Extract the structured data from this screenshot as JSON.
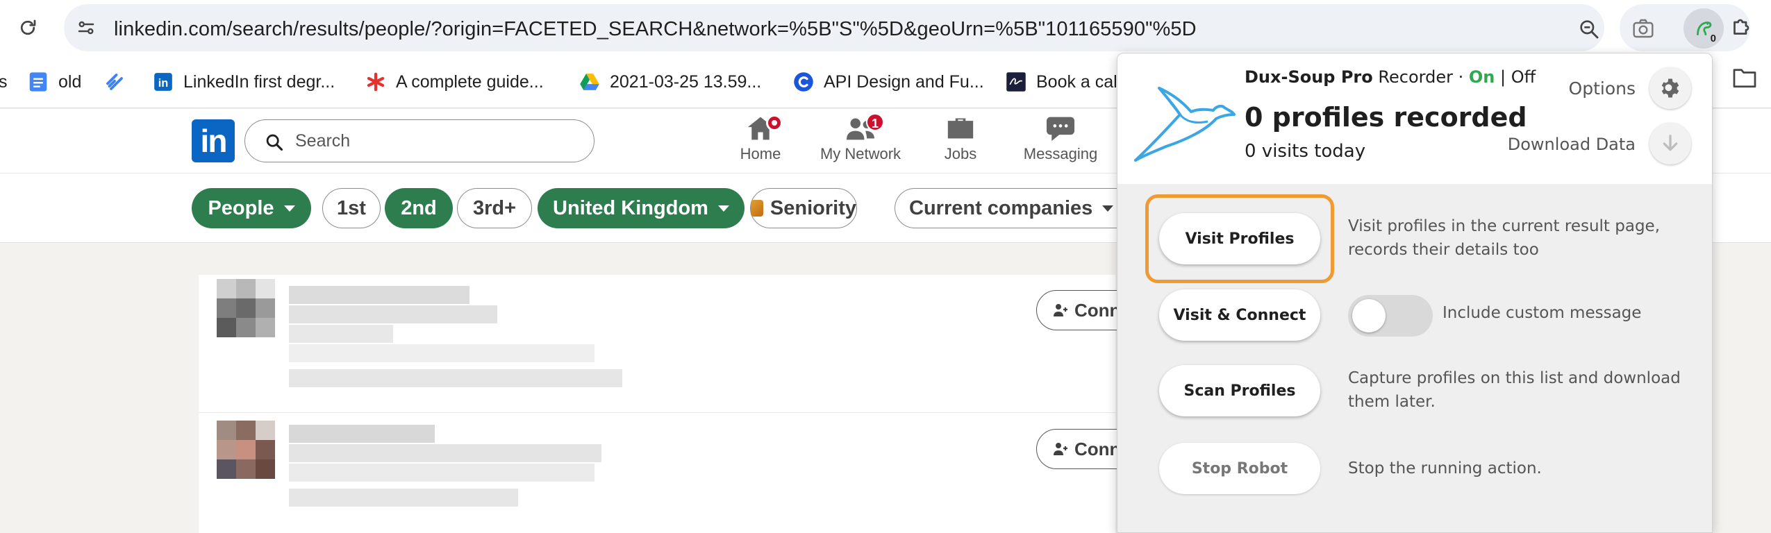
{
  "browser": {
    "url": "linkedin.com/search/results/people/?origin=FACETED_SEARCH&network=%5B\"S\"%5D&geoUrn=%5B\"101165590\"%5D",
    "extension_badge": "0"
  },
  "bookmarks": [
    {
      "label": "s",
      "icon": "partial"
    },
    {
      "label": "old",
      "icon": "docs-icon"
    },
    {
      "label": "",
      "icon": "zapier-like-icon"
    },
    {
      "label": "LinkedIn first degr...",
      "icon": "linkedin-icon"
    },
    {
      "label": "A complete guide...",
      "icon": "asterisk-icon"
    },
    {
      "label": "2021-03-25 13.59...",
      "icon": "drive-icon"
    },
    {
      "label": "API Design and Fu...",
      "icon": "c-icon"
    },
    {
      "label": "Book a cal",
      "icon": "signature-icon"
    }
  ],
  "linkedin": {
    "logo": "in",
    "search_placeholder": "Search",
    "nav": [
      {
        "label": "Home",
        "icon": "home-icon",
        "badge": "dot"
      },
      {
        "label": "My Network",
        "icon": "network-icon",
        "badge": "1"
      },
      {
        "label": "Jobs",
        "icon": "briefcase-icon"
      },
      {
        "label": "Messaging",
        "icon": "messaging-icon"
      }
    ],
    "filters": {
      "people": "People",
      "first": "1st",
      "second": "2nd",
      "third": "3rd+",
      "location": "United Kingdom",
      "seniority": "Seniority",
      "companies": "Current companies"
    },
    "connect_label": "Connect"
  },
  "duxsoup": {
    "product": "Dux-Soup Pro",
    "recorder": " Recorder · ",
    "on": "On",
    "separator": " | ",
    "off": "Off",
    "profiles_recorded": "0 profiles recorded",
    "visits_today": "0 visits today",
    "options_label": "Options",
    "download_label": "Download Data",
    "actions": [
      {
        "button": "Visit Profiles",
        "desc": "Visit profiles in the current result page, records their details too"
      },
      {
        "button": "Visit & Connect",
        "desc": "Include custom message"
      },
      {
        "button": "Scan Profiles",
        "desc": "Capture profiles on this list and download them later."
      },
      {
        "button": "Stop Robot",
        "desc": "Stop the running action."
      }
    ],
    "custom_message_enabled": false,
    "colors": {
      "on": "#2fa84f",
      "highlight": "#ef9a32",
      "logo": "#3aa6e4"
    }
  }
}
